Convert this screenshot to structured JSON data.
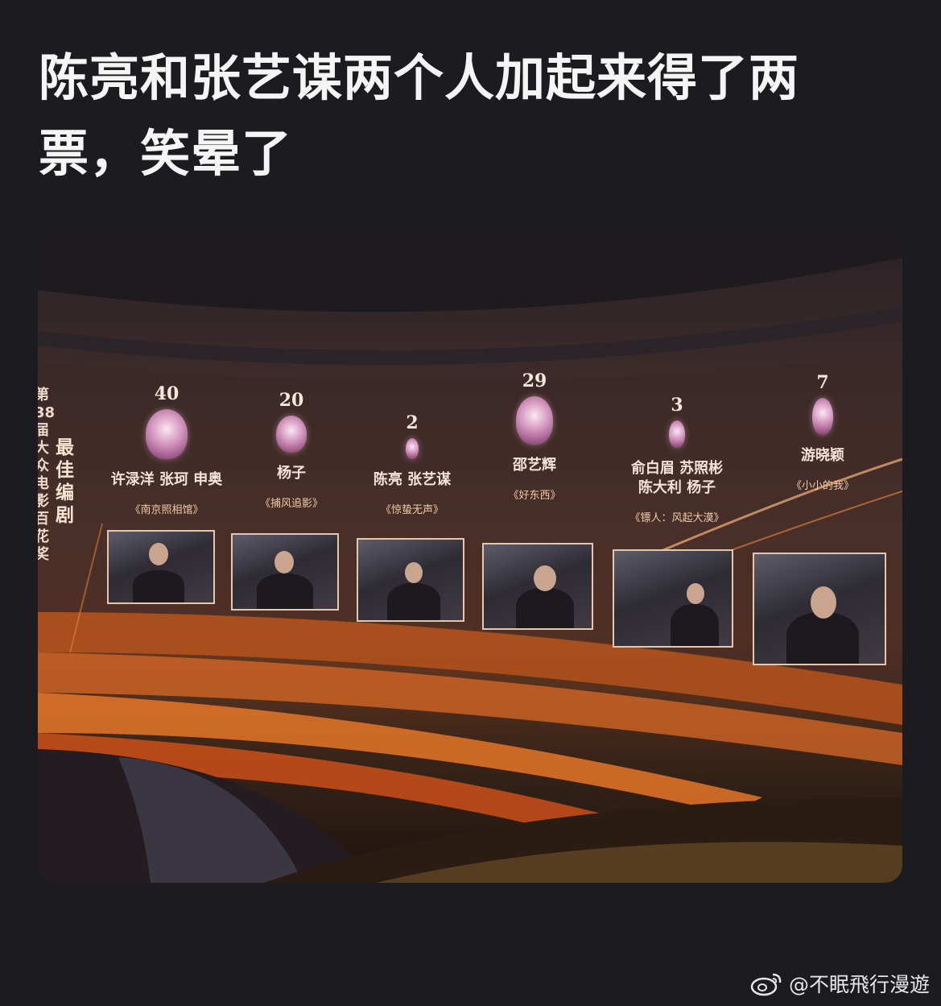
{
  "post": {
    "title": "陈亮和张艺谋两个人加起来得了两票，笑晕了"
  },
  "screen": {
    "side_title": "第38届大众电影百花奖",
    "side_subtitle": "最佳编剧",
    "nominees": [
      {
        "votes": "40",
        "names": "许渌洋 张珂 申奥",
        "film": "《南京照相馆》"
      },
      {
        "votes": "20",
        "names": "杨子",
        "film": "《捕风追影》"
      },
      {
        "votes": "2",
        "names": "陈亮 张艺谋",
        "film": "《惊蛰无声》"
      },
      {
        "votes": "29",
        "names": "邵艺辉",
        "film": "《好东西》"
      },
      {
        "votes": "3",
        "names": "俞白眉 苏照彬\n陈大利 杨子",
        "film": "《镖人：风起大漠》"
      },
      {
        "votes": "7",
        "names": "游晓颖",
        "film": "《小小的我》"
      }
    ]
  },
  "watermark": {
    "icon": "weibo-icon",
    "text": "@不眠飛行漫遊"
  },
  "colors": {
    "background": "#1c1c20",
    "title": "#f5f5f5",
    "accent_orange": "#f07a2a"
  }
}
